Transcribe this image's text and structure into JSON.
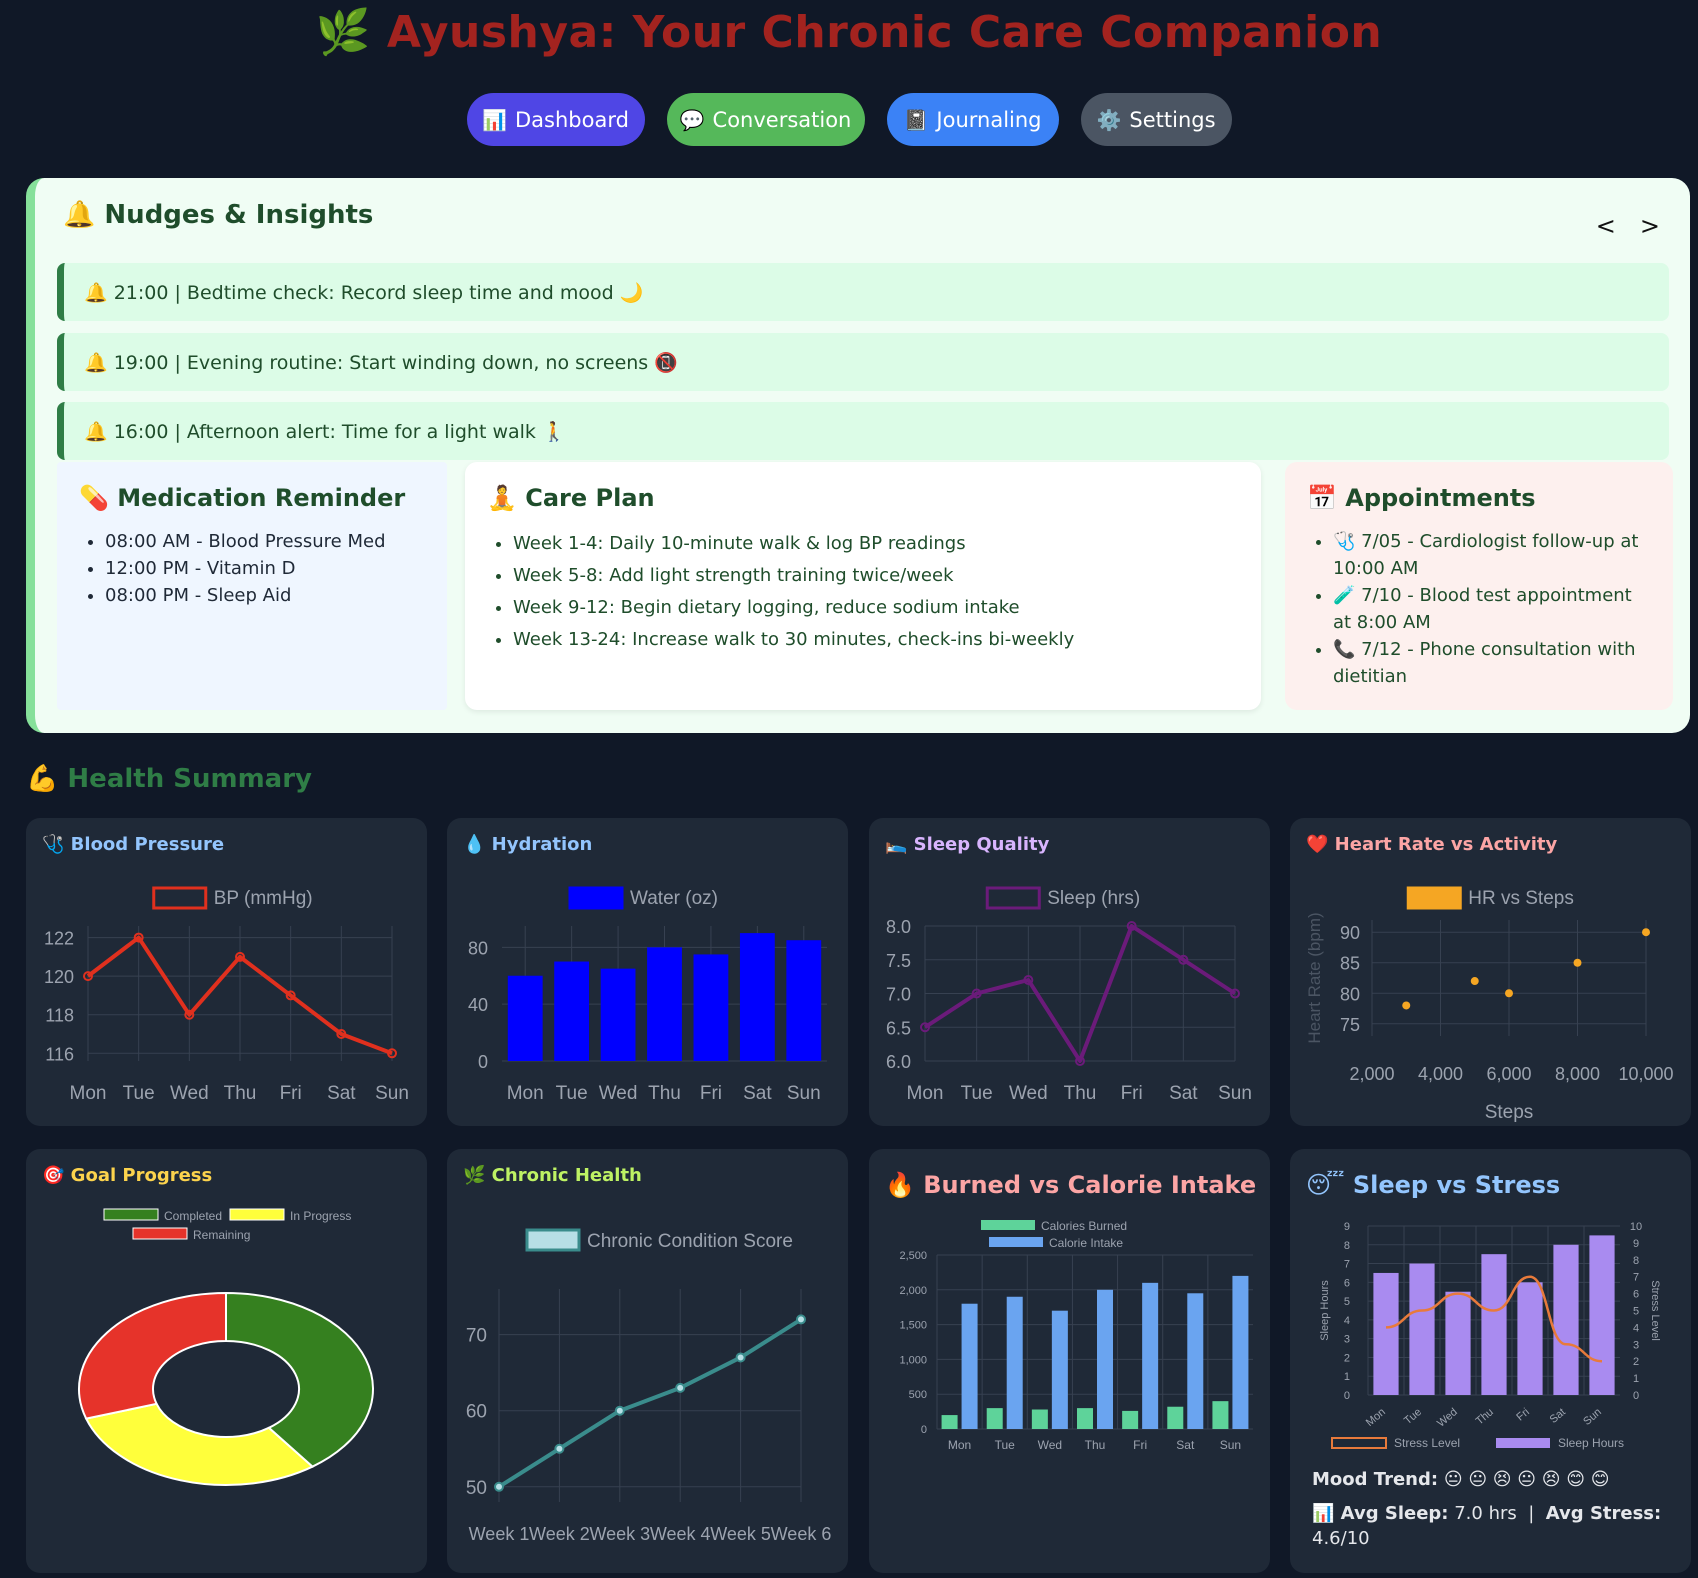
{
  "app": {
    "title": "🌿 Ayushya: Your Chronic Care Companion"
  },
  "nav": [
    {
      "icon": "📊",
      "label": "Dashboard"
    },
    {
      "icon": "💬",
      "label": "Conversation"
    },
    {
      "icon": "📓",
      "label": "Journaling"
    },
    {
      "icon": "⚙️",
      "label": "Settings"
    }
  ],
  "nudges": {
    "title": "🔔 Nudges & Insights",
    "prev": "<",
    "next": ">",
    "items": [
      "🔔 21:00 | Bedtime check: Record sleep time and mood 🌙",
      "🔔 19:00 | Evening routine: Start winding down, no screens 📵",
      "🔔 16:00 | Afternoon alert: Time for a light walk 🚶"
    ]
  },
  "medication": {
    "title": "💊 Medication Reminder",
    "items": [
      "08:00 AM - Blood Pressure Med",
      "12:00 PM - Vitamin D",
      "08:00 PM - Sleep Aid"
    ]
  },
  "care_plan": {
    "title": "🧘 Care Plan",
    "items": [
      "Week 1-4: Daily 10-minute walk & log BP readings",
      "Week 5-8: Add light strength training twice/week",
      "Week 9-12: Begin dietary logging, reduce sodium intake",
      "Week 13-24: Increase walk to 30 minutes, check-ins bi-weekly"
    ]
  },
  "appointments": {
    "title": "📅 Appointments",
    "items": [
      "🩺 7/05 - Cardiologist follow-up at 10:00 AM",
      "🧪 7/10 - Blood test appointment at 8:00 AM",
      "📞 7/12 - Phone consultation with dietitian"
    ]
  },
  "summary": {
    "title": "💪 Health Summary"
  },
  "colors": {
    "bp": "#e0301e",
    "water": "#0000ff",
    "sleep": "#6b1b7a",
    "hr": "#f5a623",
    "completed": "#35801f",
    "in_progress": "#ffff3b",
    "remaining": "#e6332a",
    "chronic": "#3a8c8c",
    "burned": "#5ed39a",
    "intake": "#6aa4f0",
    "stress": "#e87a3b",
    "sleep_hours": "#a98bf0"
  },
  "chart_data": [
    {
      "id": "bp",
      "type": "line",
      "title": "🩺 Blood Pressure",
      "categories": [
        "Mon",
        "Tue",
        "Wed",
        "Thu",
        "Fri",
        "Sat",
        "Sun"
      ],
      "series": [
        {
          "name": "BP (mmHg)",
          "values": [
            120,
            122,
            118,
            121,
            119,
            117,
            116
          ]
        }
      ],
      "yticks": [
        116,
        118,
        120,
        122
      ],
      "ylim": [
        115.6,
        122.6
      ]
    },
    {
      "id": "water",
      "type": "bar",
      "title": "💧 Hydration",
      "categories": [
        "Mon",
        "Tue",
        "Wed",
        "Thu",
        "Fri",
        "Sat",
        "Sun"
      ],
      "series": [
        {
          "name": "Water (oz)",
          "values": [
            60,
            70,
            65,
            80,
            75,
            90,
            85
          ]
        }
      ],
      "yticks": [
        0,
        40,
        80
      ],
      "ylim": [
        0,
        95
      ]
    },
    {
      "id": "sleep",
      "type": "line",
      "title": "🛌 Sleep Quality",
      "categories": [
        "Mon",
        "Tue",
        "Wed",
        "Thu",
        "Fri",
        "Sat",
        "Sun"
      ],
      "series": [
        {
          "name": "Sleep (hrs)",
          "values": [
            6.5,
            7.0,
            7.2,
            6.0,
            8.0,
            7.5,
            7.0
          ]
        }
      ],
      "yticks": [
        "6.0",
        "6.5",
        "7.0",
        "7.5",
        "8.0"
      ],
      "ylim": [
        6.0,
        8.0
      ]
    },
    {
      "id": "hr",
      "type": "scatter",
      "title": "❤️ Heart Rate vs Activity",
      "series": [
        {
          "name": "HR vs Steps",
          "points": [
            [
              3000,
              78
            ],
            [
              5000,
              82
            ],
            [
              6000,
              80
            ],
            [
              8000,
              85
            ],
            [
              10000,
              90
            ]
          ]
        }
      ],
      "xlabel": "Steps",
      "ylabel": "Heart Rate (bpm)",
      "xticks": [
        "2,000",
        "4,000",
        "6,000",
        "8,000",
        "10,000"
      ],
      "xlim": [
        2000,
        10000
      ],
      "yticks": [
        75,
        80,
        85,
        90
      ],
      "ylim": [
        73,
        92
      ]
    },
    {
      "id": "goal",
      "type": "pie",
      "title": "🎯 Goal Progress",
      "labels": [
        "Completed",
        "In Progress",
        "Remaining"
      ],
      "values": [
        40,
        30,
        30
      ]
    },
    {
      "id": "chronic",
      "type": "line",
      "title": "🌿 Chronic Health",
      "categories": [
        "Week 1",
        "Week 2",
        "Week 3",
        "Week 4",
        "Week 5",
        "Week 6"
      ],
      "series": [
        {
          "name": "Chronic Condition Score",
          "values": [
            50,
            55,
            60,
            63,
            67,
            72
          ]
        }
      ],
      "yticks": [
        50,
        60,
        70
      ],
      "ylim": [
        48,
        76
      ]
    },
    {
      "id": "calories",
      "type": "bar",
      "title": "🔥 Burned vs Calorie Intake",
      "categories": [
        "Mon",
        "Tue",
        "Wed",
        "Thu",
        "Fri",
        "Sat",
        "Sun"
      ],
      "series": [
        {
          "name": "Calories Burned",
          "values": [
            200,
            300,
            280,
            300,
            260,
            320,
            400
          ]
        },
        {
          "name": "Calorie Intake",
          "values": [
            1800,
            1900,
            1700,
            2000,
            2100,
            1950,
            2200
          ]
        }
      ],
      "yticks": [
        "0",
        "500",
        "1,000",
        "1,500",
        "2,000",
        "2,500"
      ],
      "ylim": [
        0,
        2500
      ]
    },
    {
      "id": "sleepstress",
      "type": "bar",
      "title": "😴 Sleep vs Stress",
      "categories": [
        "Mon",
        "Tue",
        "Wed",
        "Thu",
        "Fri",
        "Sat",
        "Sun"
      ],
      "series": [
        {
          "name": "Stress Level",
          "values": [
            4,
            5,
            6,
            5,
            7,
            3,
            2
          ]
        },
        {
          "name": "Sleep Hours",
          "values": [
            6.5,
            7.0,
            5.5,
            7.5,
            6.0,
            8.0,
            8.5
          ]
        }
      ],
      "ylabel": "Sleep Hours",
      "y2label": "Stress Level",
      "yticks": [
        "0",
        "1",
        "2",
        "3",
        "4",
        "5",
        "6",
        "7",
        "8",
        "9"
      ],
      "ylim": [
        0,
        9
      ],
      "y2ticks": [
        "0",
        "1",
        "2",
        "3",
        "4",
        "5",
        "6",
        "7",
        "8",
        "9",
        "10"
      ],
      "y2lim": [
        0,
        10
      ]
    }
  ],
  "mood": {
    "label": "Mood Trend:",
    "emojis": "😐 😐 😣 😐 😣 😊 😊",
    "avg_sleep_label": "📊 Avg Sleep:",
    "avg_sleep_value": "7.0 hrs",
    "separator": "|",
    "avg_stress_label": "Avg Stress:",
    "avg_stress_value": "4.6/10"
  }
}
